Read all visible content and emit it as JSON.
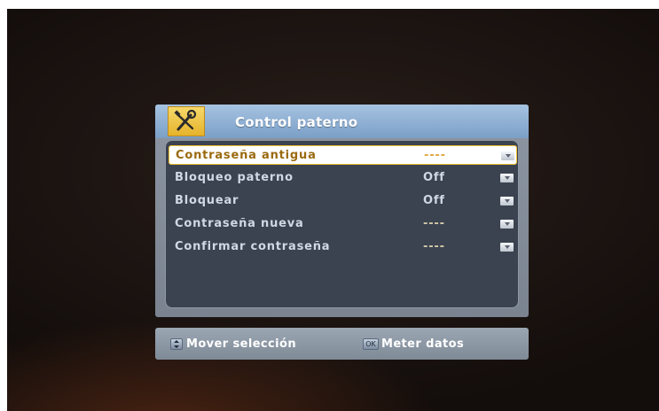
{
  "window": {
    "title": "Control paterno",
    "icon": "tools-icon"
  },
  "menu": {
    "items": [
      {
        "label": "Contraseña antigua",
        "value": "----",
        "selected": true
      },
      {
        "label": "Bloqueo paterno",
        "value": "Off",
        "selected": false
      },
      {
        "label": "Bloquear",
        "value": "Off",
        "selected": false
      },
      {
        "label": "Contraseña nueva",
        "value": "----",
        "selected": false
      },
      {
        "label": "Confirmar contraseña",
        "value": "----",
        "selected": false
      }
    ]
  },
  "footer": {
    "move_label": "Mover selección",
    "move_icon": "move-arrows-icon",
    "enter_label": "Meter datos",
    "enter_icon": "ok-key-icon",
    "enter_icon_text": "OK"
  },
  "colors": {
    "accent": "#f0c030",
    "header": "#7b9fc7",
    "list_bg": "#3c4350"
  }
}
